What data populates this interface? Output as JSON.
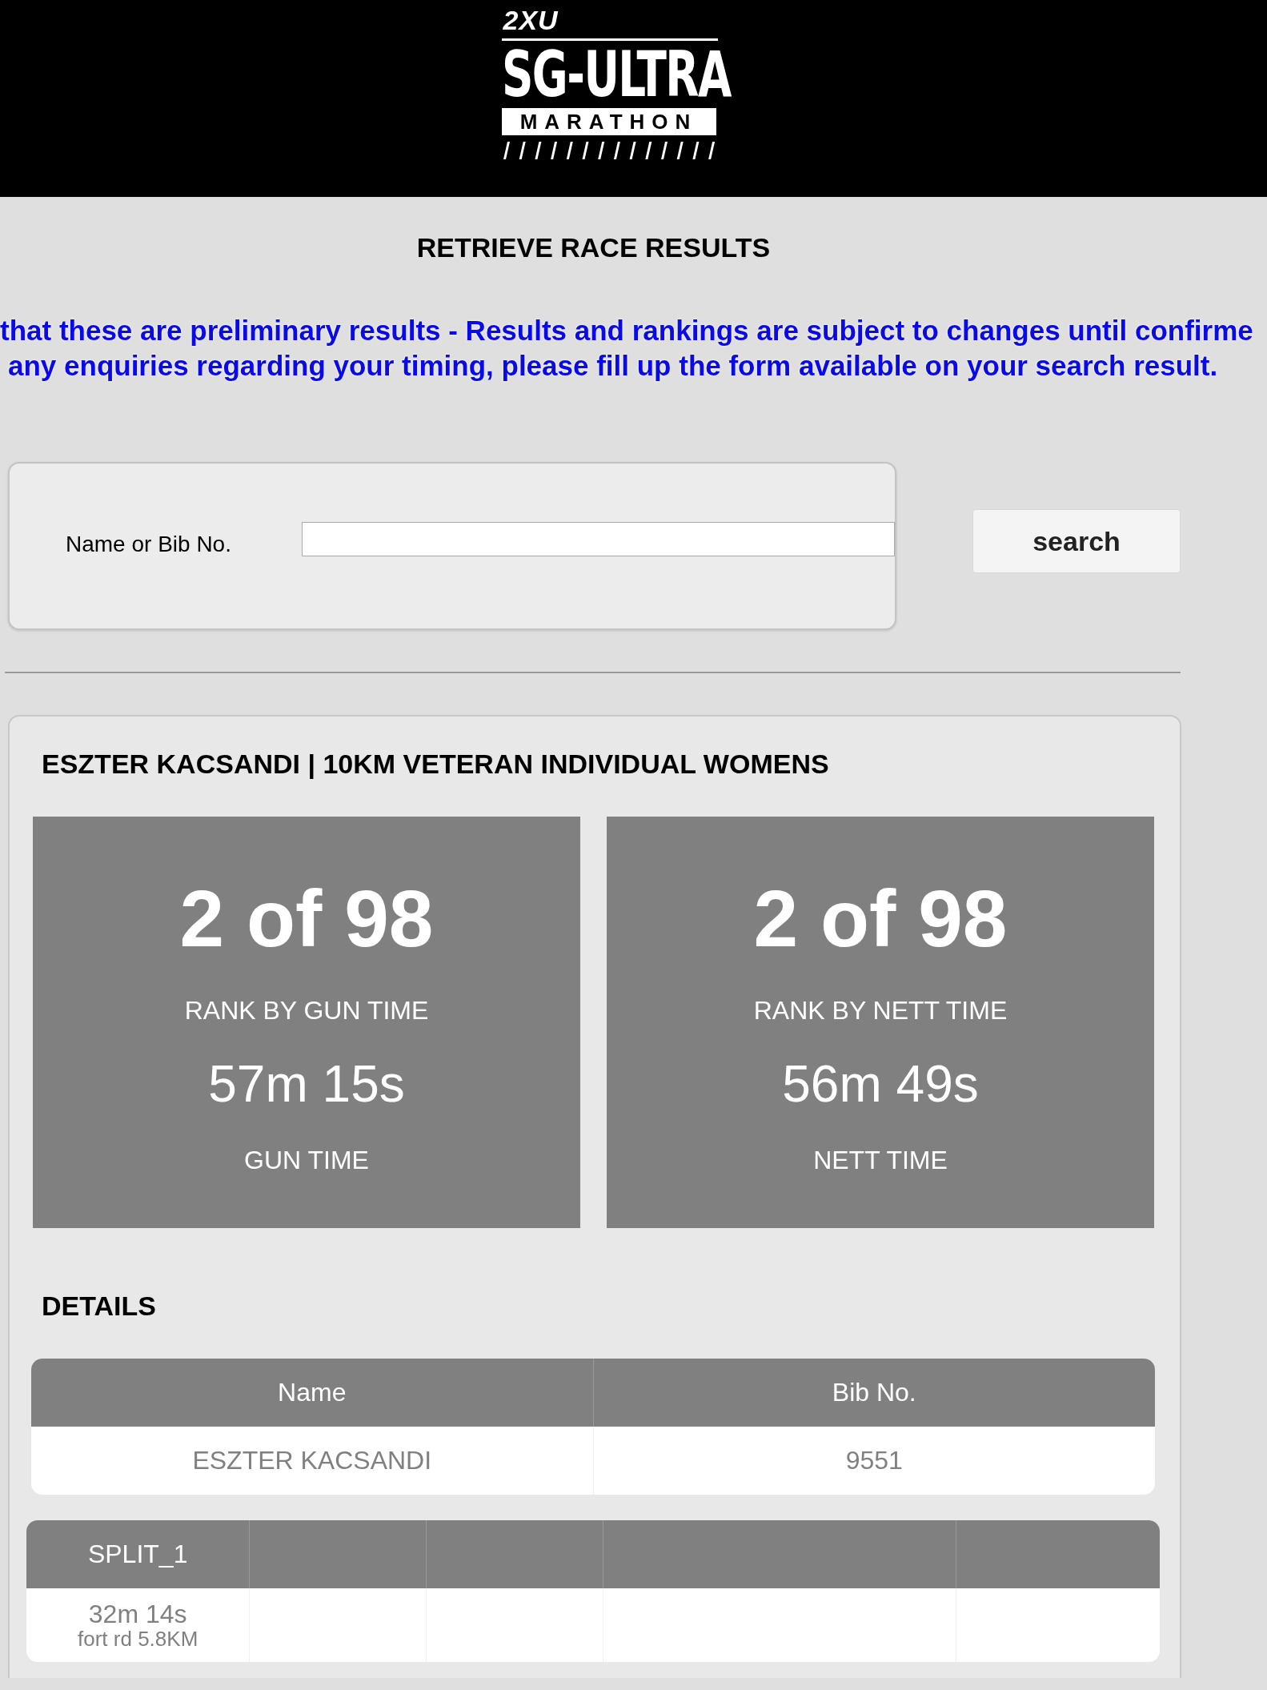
{
  "logo": {
    "brand": "2XU",
    "title": "SG-ULTRA",
    "subtitle": "MARATHON"
  },
  "page_title": "RETRIEVE RACE RESULTS",
  "notice_lines": [
    "that these are preliminary results - Results and rankings are subject to changes until confirme",
    "any enquiries regarding your timing, please fill up the form available on your search result."
  ],
  "search": {
    "label": "Name or Bib No.",
    "button": "search"
  },
  "result": {
    "title": "ESZTER KACSANDI | 10KM VETERAN INDIVIDUAL WOMENS",
    "stats": [
      {
        "rank": "2 of 98",
        "rank_label": "RANK BY GUN TIME",
        "time": "57m 15s",
        "time_label": "GUN TIME"
      },
      {
        "rank": "2 of 98",
        "rank_label": "RANK BY NETT TIME",
        "time": "56m 49s",
        "time_label": "NETT TIME"
      }
    ],
    "details_heading": "DETAILS",
    "details_table": {
      "columns": [
        "Name",
        "Bib No."
      ],
      "rows": [
        [
          "ESZTER KACSANDI",
          "9551"
        ]
      ]
    },
    "splits_table": {
      "columns": [
        "SPLIT_1",
        "",
        "",
        "",
        ""
      ],
      "rows": [
        [
          {
            "time": "32m 14s",
            "place": "fort rd 5.8KM"
          },
          null,
          null,
          null,
          null
        ]
      ]
    }
  }
}
